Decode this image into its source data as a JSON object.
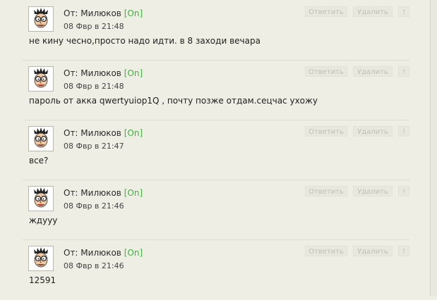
{
  "messages": [
    {
      "author_prefix": "От: Милюков",
      "status": "[On]",
      "time": "08 Фвр в 21:48",
      "text": "не кину чесно,просто надо идти. в 8 заходи вечара",
      "reply_label": "Ответить",
      "delete_label": "Удалить",
      "warn_label": "!"
    },
    {
      "author_prefix": "От: Милюков",
      "status": "[On]",
      "time": "08 Фвр в 21:48",
      "text": "пароль от акка qwertyuiop1Q , почту позже отдам.сецчас ухожу",
      "reply_label": "Ответить",
      "delete_label": "Удалить",
      "warn_label": "!"
    },
    {
      "author_prefix": "От: Милюков",
      "status": "[On]",
      "time": "08 Фвр в 21:47",
      "text": "все?",
      "reply_label": "Ответить",
      "delete_label": "Удалить",
      "warn_label": "!"
    },
    {
      "author_prefix": "От: Милюков",
      "status": "[On]",
      "time": "08 Фвр в 21:46",
      "text": "ждууу",
      "reply_label": "Ответить",
      "delete_label": "Удалить",
      "warn_label": "!"
    },
    {
      "author_prefix": "От: Милюков",
      "status": "[On]",
      "time": "08 Фвр в 21:46",
      "text": "12591",
      "reply_label": "Ответить",
      "delete_label": "Удалить",
      "warn_label": "!"
    }
  ],
  "colors": {
    "background": "#efeee4",
    "online": "#3bb43b",
    "button_text": "#c0bfb5"
  },
  "icons": {
    "avatar": "cartoon-face-avatar-icon"
  }
}
